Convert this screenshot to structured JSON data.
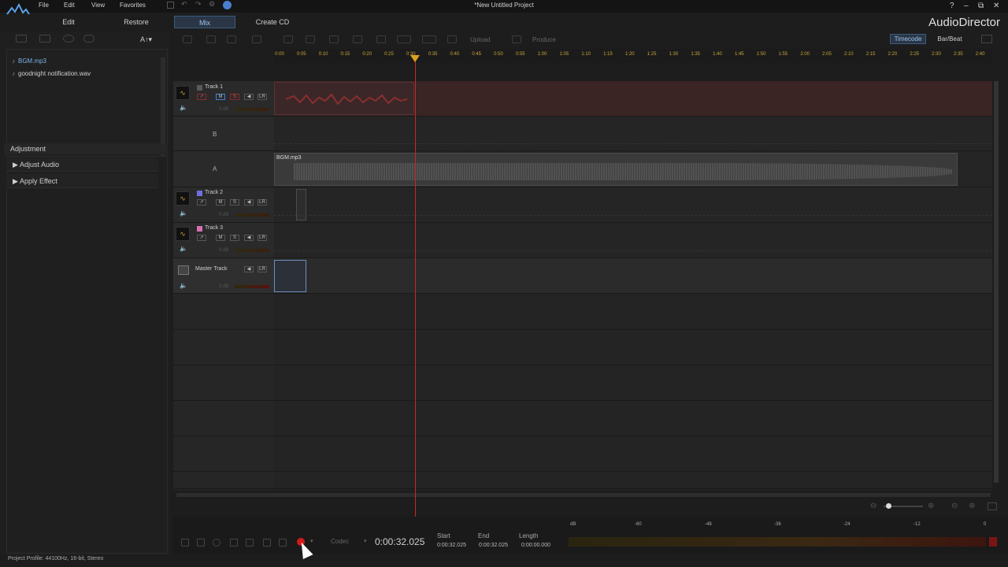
{
  "window": {
    "title": "*New Untitled Project",
    "brand": "AudioDirector",
    "controls": [
      "?",
      "–",
      "⧉",
      "✕"
    ]
  },
  "menu": [
    "File",
    "Edit",
    "View",
    "Favorites"
  ],
  "modes": {
    "edit": "Edit",
    "restore": "Restore",
    "mix": "Mix",
    "create_cd": "Create CD"
  },
  "library": {
    "text_tool": "A↑▾",
    "files": [
      "BGM.mp3",
      "goodnight notification.wav"
    ]
  },
  "adjustment": {
    "title": "Adjustment",
    "items": [
      "Adjust Audio",
      "Apply Effect"
    ]
  },
  "toolbar": {
    "upload": "Upload",
    "produce": "Produce",
    "timecode": "Timecode",
    "barbeat": "Bar/Beat"
  },
  "ruler": [
    "0:00",
    "0:05",
    "0:10",
    "0:15",
    "0:20",
    "0:25",
    "0:30",
    "0:35",
    "0:40",
    "0:45",
    "0:50",
    "0:55",
    "1:00",
    "1:05",
    "1:10",
    "1:15",
    "1:20",
    "1:25",
    "1:30",
    "1:35",
    "1:40",
    "1:45",
    "1:50",
    "1:55",
    "2:00",
    "2:05",
    "2:10",
    "2:15",
    "2:20",
    "2:25",
    "2:30",
    "2:35",
    "2:40"
  ],
  "tracks": {
    "track1": {
      "name": "Track 1",
      "color": "#5a5a5a",
      "m": "M",
      "s": "S",
      "lr": "LR",
      "db": "0 dB"
    },
    "sub_b": "B",
    "sub_a": "A",
    "clip_bgm": "BGM.mp3",
    "track2": {
      "name": "Track 2",
      "color": "#6f6fe0",
      "s": "S",
      "lr": "LR",
      "db": "0 dB"
    },
    "track3": {
      "name": "Track 3",
      "color": "#d86fb0",
      "s": "S",
      "lr": "LR",
      "db": "0 dB"
    },
    "master": {
      "name": "Master Track",
      "lr": "LR",
      "db": "0 dB"
    }
  },
  "transport": {
    "codec": "Codec",
    "timecode": "0:00:32.025",
    "start_label": "Start",
    "start_value": "0:00:32.025",
    "end_label": "End",
    "end_value": "0:00:32.025",
    "length_label": "Length",
    "length_value": "0:00:00.000",
    "vu_labels": [
      "dB",
      "-60",
      "-48",
      "-36",
      "-24",
      "-12",
      "0"
    ]
  },
  "status": "Project Profile: 44100Hz, 16-bit, Stereo"
}
